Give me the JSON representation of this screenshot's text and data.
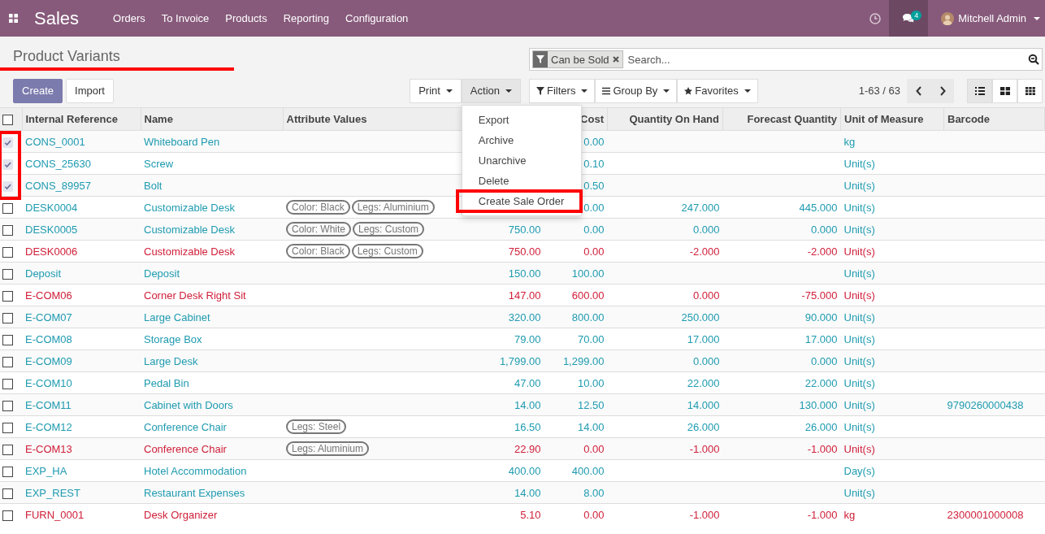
{
  "navbar": {
    "app": "Sales",
    "menu": [
      "Orders",
      "To Invoice",
      "Products",
      "Reporting",
      "Configuration"
    ],
    "messages_badge": "4",
    "user": "Mitchell Admin"
  },
  "control_panel": {
    "title": "Product Variants",
    "title_underlined": true,
    "search": {
      "facet": "Can be Sold",
      "placeholder": "Search..."
    },
    "buttons": [
      "Create",
      "Import"
    ],
    "dropdowns": [
      {
        "label": "Print",
        "open": false
      },
      {
        "label": "Action",
        "open": true
      }
    ],
    "search_buttons": [
      "Filters",
      "Group By",
      "Favorites"
    ],
    "pager": "1-63 / 63",
    "views": [
      {
        "kind": "list",
        "selected": true
      },
      {
        "kind": "kanban",
        "selected": false
      },
      {
        "kind": "grid",
        "selected": false
      }
    ]
  },
  "action_menu": [
    {
      "label": "Export",
      "highlighted": false
    },
    {
      "label": "Archive",
      "highlighted": false
    },
    {
      "label": "Unarchive",
      "highlighted": false
    },
    {
      "label": "Delete",
      "highlighted": false
    },
    {
      "label": "Create Sale Order",
      "highlighted": true
    }
  ],
  "table": {
    "selection_highlighted": true,
    "all_selected": false,
    "columns": [
      "Internal Reference",
      "Name",
      "Attribute Values",
      null,
      "Cost",
      "Quantity On Hand",
      "Forecast Quantity",
      "Unit of Measure",
      "Barcode"
    ],
    "rows": [
      {
        "selected": true,
        "alert": false,
        "cells": [
          "CONS_0001",
          "Whiteboard Pen",
          null,
          null,
          "0.00",
          null,
          null,
          "kg",
          null
        ]
      },
      {
        "selected": true,
        "alert": false,
        "cells": [
          "CONS_25630",
          "Screw",
          null,
          null,
          "0.10",
          null,
          null,
          "Unit(s)",
          null
        ]
      },
      {
        "selected": true,
        "alert": false,
        "cells": [
          "CONS_89957",
          "Bolt",
          null,
          null,
          "0.50",
          null,
          null,
          "Unit(s)",
          null
        ]
      },
      {
        "selected": false,
        "alert": false,
        "cells": [
          "DESK0004",
          "Customizable Desk",
          [
            "Color: Black",
            "Legs: Aluminium"
          ],
          null,
          "0.00",
          "247.000",
          "445.000",
          "Unit(s)",
          null
        ]
      },
      {
        "selected": false,
        "alert": false,
        "cells": [
          "DESK0005",
          "Customizable Desk",
          [
            "Color: White",
            "Legs: Custom"
          ],
          "750.00",
          "0.00",
          "0.000",
          "0.000",
          "Unit(s)",
          null
        ]
      },
      {
        "selected": false,
        "alert": true,
        "cells": [
          "DESK0006",
          "Customizable Desk",
          [
            "Color: Black",
            "Legs: Custom"
          ],
          "750.00",
          "0.00",
          "-2.000",
          "-2.000",
          "Unit(s)",
          null
        ]
      },
      {
        "selected": false,
        "alert": false,
        "cells": [
          "Deposit",
          "Deposit",
          null,
          "150.00",
          "100.00",
          null,
          null,
          "Unit(s)",
          null
        ]
      },
      {
        "selected": false,
        "alert": true,
        "cells": [
          "E-COM06",
          "Corner Desk Right Sit",
          null,
          "147.00",
          "600.00",
          "0.000",
          "-75.000",
          "Unit(s)",
          null
        ]
      },
      {
        "selected": false,
        "alert": false,
        "cells": [
          "E-COM07",
          "Large Cabinet",
          null,
          "320.00",
          "800.00",
          "250.000",
          "90.000",
          "Unit(s)",
          null
        ]
      },
      {
        "selected": false,
        "alert": false,
        "cells": [
          "E-COM08",
          "Storage Box",
          null,
          "79.00",
          "70.00",
          "17.000",
          "17.000",
          "Unit(s)",
          null
        ]
      },
      {
        "selected": false,
        "alert": false,
        "cells": [
          "E-COM09",
          "Large Desk",
          null,
          "1,799.00",
          "1,299.00",
          "0.000",
          "0.000",
          "Unit(s)",
          null
        ]
      },
      {
        "selected": false,
        "alert": false,
        "cells": [
          "E-COM10",
          "Pedal Bin",
          null,
          "47.00",
          "10.00",
          "22.000",
          "22.000",
          "Unit(s)",
          null
        ]
      },
      {
        "selected": false,
        "alert": false,
        "cells": [
          "E-COM11",
          "Cabinet with Doors",
          null,
          "14.00",
          "12.50",
          "14.000",
          "130.000",
          "Unit(s)",
          "9790260000438"
        ]
      },
      {
        "selected": false,
        "alert": false,
        "cells": [
          "E-COM12",
          "Conference Chair",
          [
            "Legs: Steel"
          ],
          "16.50",
          "14.00",
          "26.000",
          "26.000",
          "Unit(s)",
          null
        ]
      },
      {
        "selected": false,
        "alert": true,
        "cells": [
          "E-COM13",
          "Conference Chair",
          [
            "Legs: Aluminium"
          ],
          "22.90",
          "0.00",
          "-1.000",
          "-1.000",
          "Unit(s)",
          null
        ]
      },
      {
        "selected": false,
        "alert": false,
        "cells": [
          "EXP_HA",
          "Hotel Accommodation",
          null,
          "400.00",
          "400.00",
          null,
          null,
          "Day(s)",
          null
        ]
      },
      {
        "selected": false,
        "alert": false,
        "cells": [
          "EXP_REST",
          "Restaurant Expenses",
          null,
          "14.00",
          "8.00",
          null,
          null,
          "Unit(s)",
          null
        ]
      },
      {
        "selected": false,
        "alert": true,
        "cells": [
          "FURN_0001",
          "Desk Organizer",
          null,
          "5.10",
          "0.00",
          "-1.000",
          "-1.000",
          "kg",
          "2300001000008"
        ]
      }
    ]
  }
}
